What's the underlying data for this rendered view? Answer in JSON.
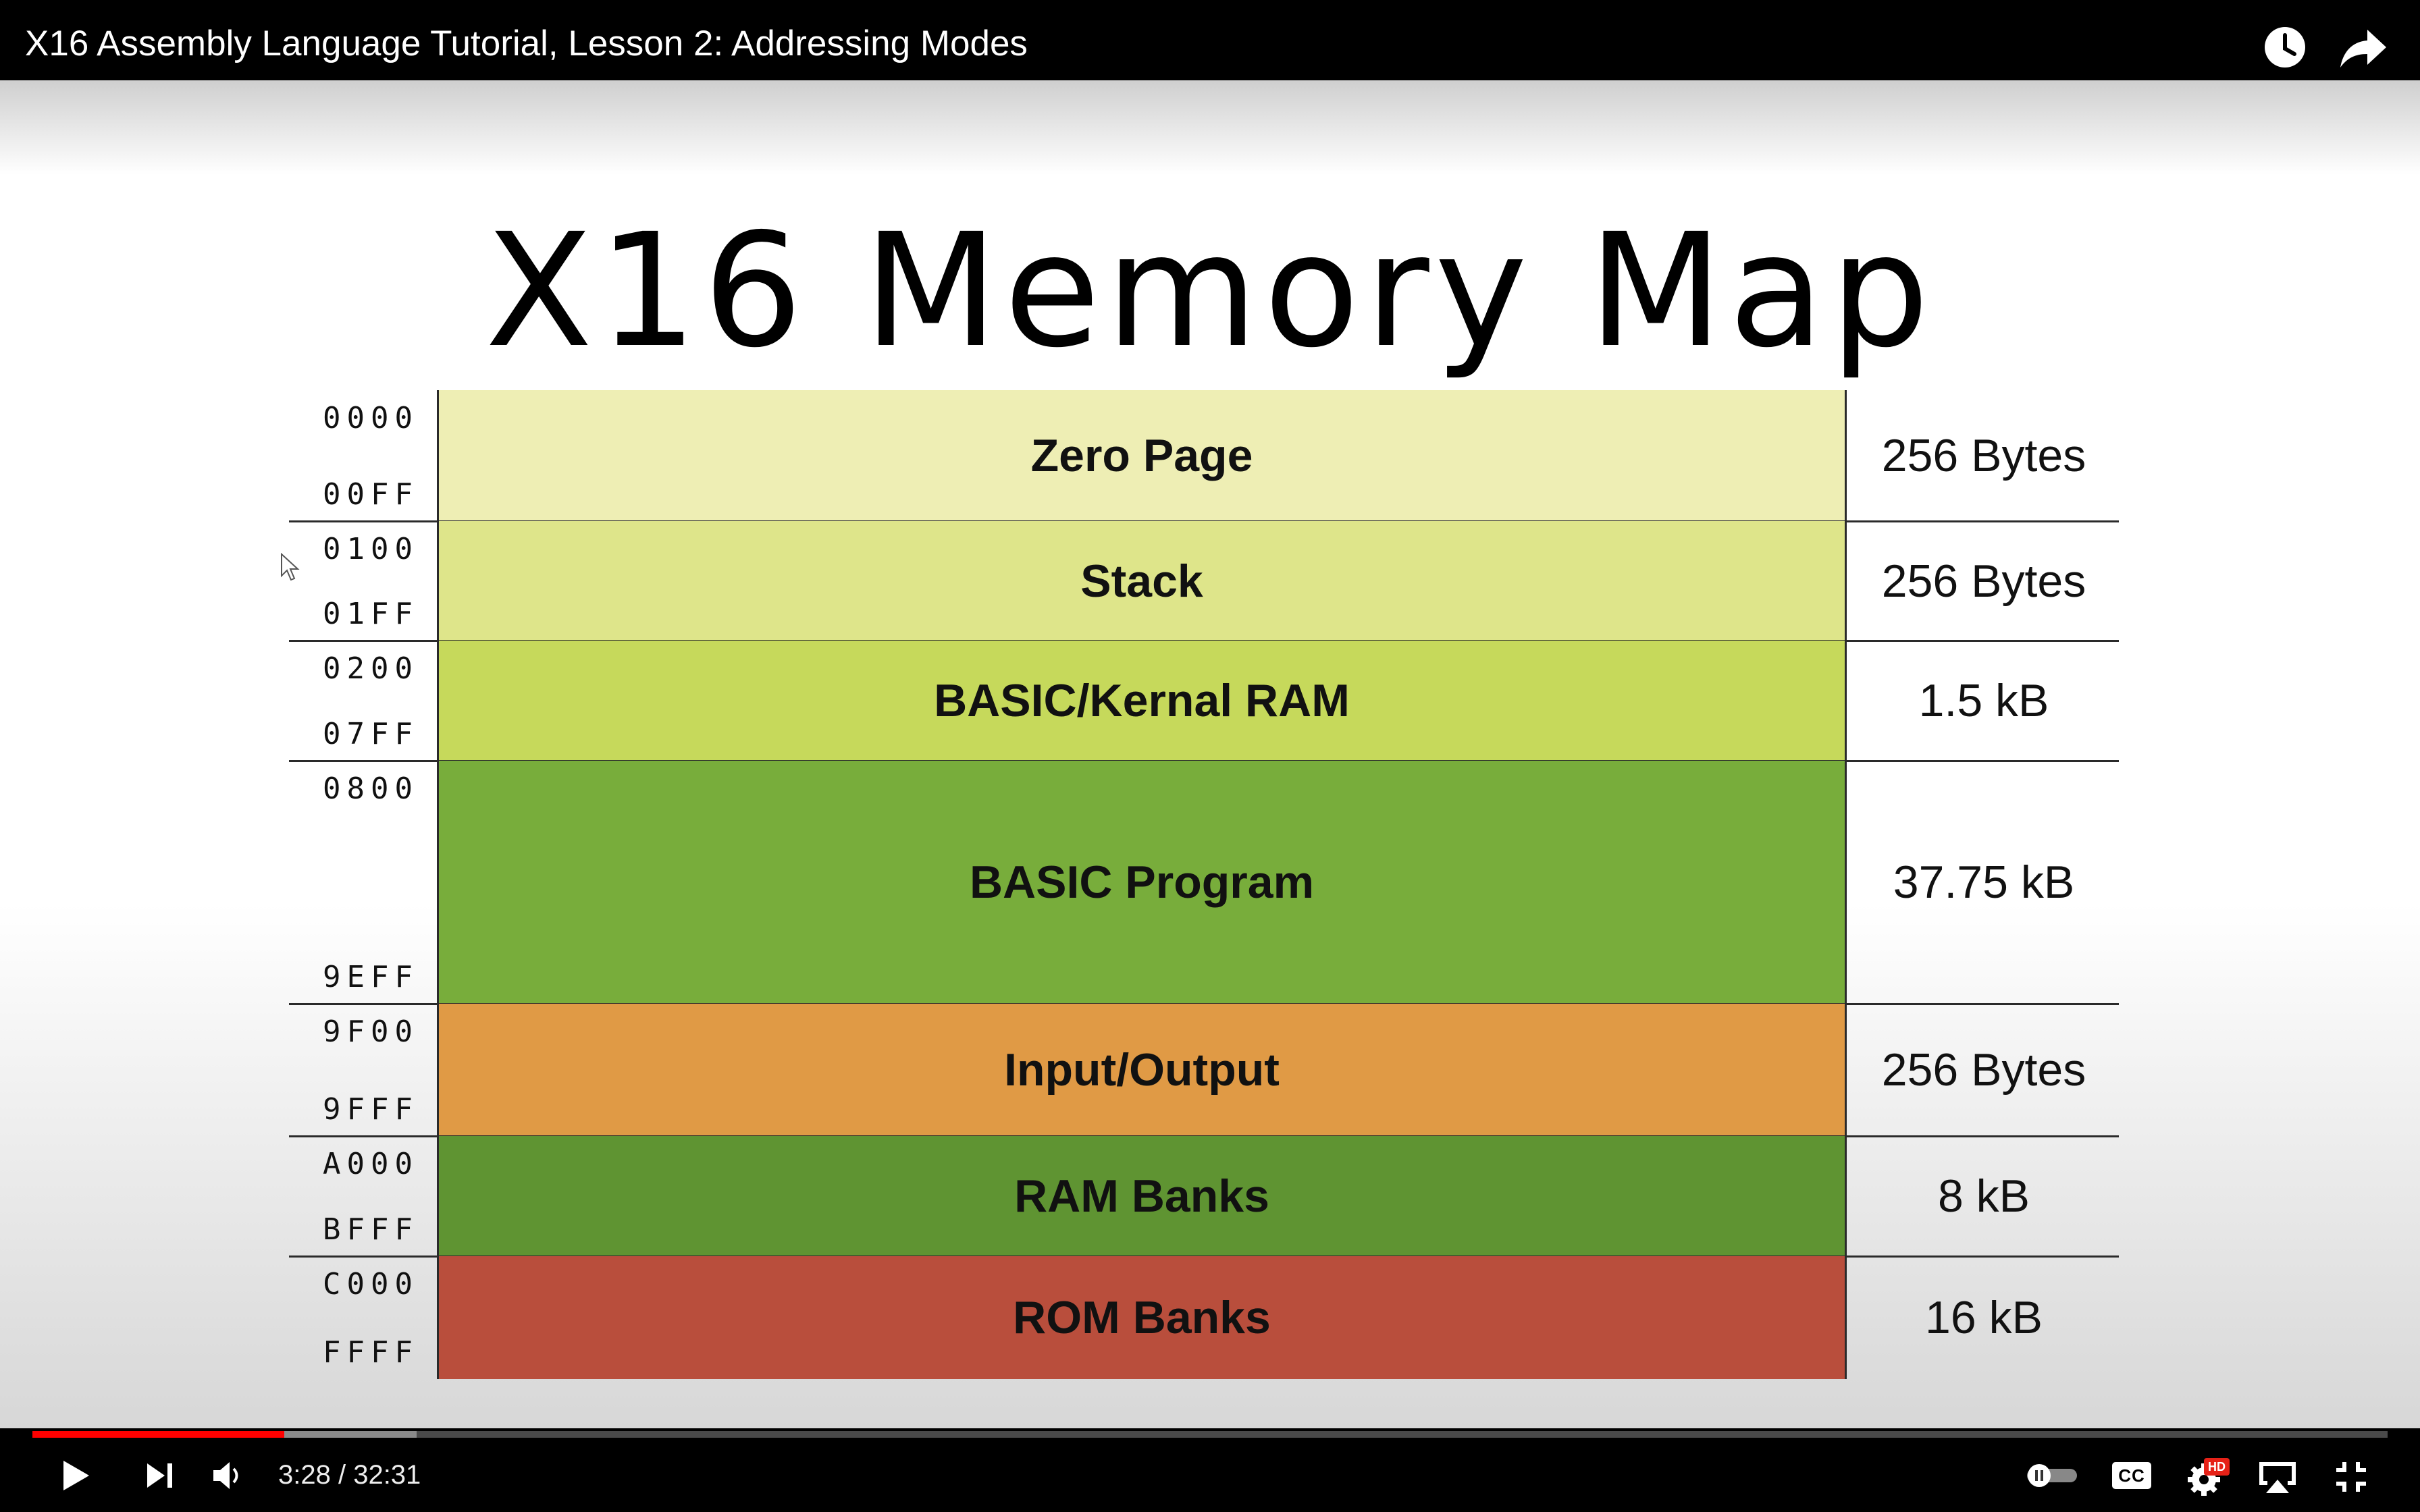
{
  "player": {
    "title": "X16 Assembly Language Tutorial, Lesson 2: Addressing Modes",
    "time_current": "3:28",
    "time_separator": " / ",
    "time_total": "32:31",
    "progress_played": 0.107,
    "progress_buffered": 0.163,
    "accent_color": "#ff0000",
    "icons": [
      "watch-later-icon",
      "share-icon",
      "play-icon",
      "next-icon",
      "volume-icon",
      "autoplay-toggle-icon",
      "captions-icon",
      "settings-icon",
      "hd-badge",
      "airplay-icon",
      "exit-fullscreen-icon"
    ],
    "hd_badge": "HD",
    "cc_label": "CC"
  },
  "slide": {
    "title": "X16 Memory Map",
    "regions": [
      {
        "name": "Zero Page",
        "start": "0000",
        "end": "00FF",
        "size": "256 Bytes",
        "color": "#eeeeb4"
      },
      {
        "name": "Stack",
        "start": "0100",
        "end": "01FF",
        "size": "256 Bytes",
        "color": "#dee58a"
      },
      {
        "name": "BASIC/Kernal RAM",
        "start": "0200",
        "end": "07FF",
        "size": "1.5 kB",
        "color": "#c6d95b"
      },
      {
        "name": "BASIC Program",
        "start": "0800",
        "end": "9EFF",
        "size": "37.75 kB",
        "color": "#78ad3b"
      },
      {
        "name": "Input/Output",
        "start": "9F00",
        "end": "9FFF",
        "size": "256 Bytes",
        "color": "#e09a45"
      },
      {
        "name": "RAM Banks",
        "start": "A000",
        "end": "BFFF",
        "size": "8 kB",
        "color": "#5f9432"
      },
      {
        "name": "ROM Banks",
        "start": "C000",
        "end": "FFFF",
        "size": "16 kB",
        "color": "#b94e3c"
      }
    ]
  }
}
